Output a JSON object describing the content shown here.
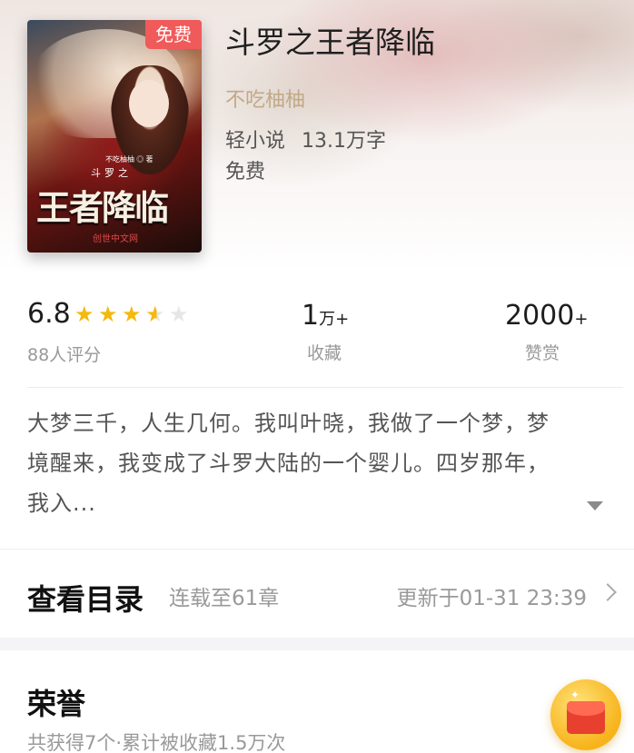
{
  "book": {
    "title": "斗罗之王者降临",
    "author": "不吃柚柚",
    "category": "轻小说",
    "word_count": "13.1万字",
    "price": "免费",
    "cover": {
      "badge": "免费",
      "author_line": "不吃柚柚 ◎ 著",
      "subtitle": "斗罗之",
      "title": "王者降临",
      "publisher": "创世中文网"
    }
  },
  "stats": {
    "score": "6.8",
    "stars": 3.5,
    "raters": "88人评分",
    "favorites_value": "1",
    "favorites_unit": "万+",
    "favorites_label": "收藏",
    "likes_value": "2000",
    "likes_unit": "+",
    "likes_label": "赞赏"
  },
  "description": {
    "line1": "大梦三千，人生几何。我叫叶晓，我做了一个梦，梦",
    "line2": "境醒来，我变成了斗罗大陆的一个婴儿。四岁那年，",
    "line3": "我入..."
  },
  "toc": {
    "title": "查看目录",
    "status": "连载至61章",
    "updated": "更新于01-31 23:39"
  },
  "honor": {
    "title": "荣誉",
    "summary": "共获得7个·累计被收藏1.5万次"
  },
  "icons": {
    "expand": "chevron-down-icon",
    "toc_arrow": "chevron-right-icon",
    "gift": "red-envelope-icon",
    "star": "star-icon"
  },
  "colors": {
    "star_on": "#f5b80c",
    "star_off": "#e6e6e6",
    "badge": "#f05a5a",
    "author": "#c1a987"
  }
}
